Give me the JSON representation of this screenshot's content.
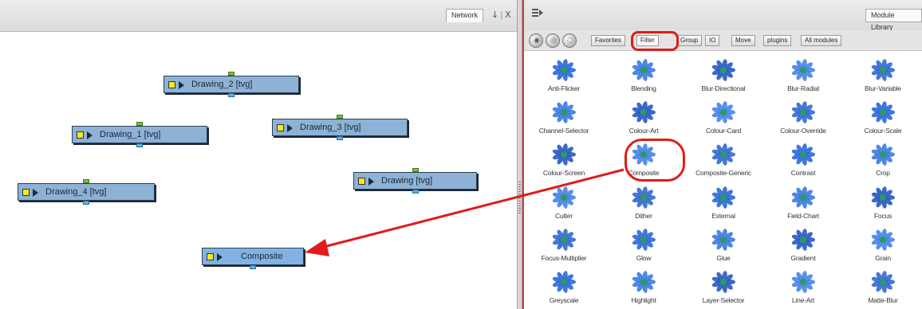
{
  "network": {
    "tab_label": "Network",
    "controls": [
      "↓",
      "|",
      "X"
    ],
    "nodes": [
      {
        "label": "Drawing_2  [tvg]",
        "selected": false
      },
      {
        "label": "Drawing_1  [tvg]",
        "selected": false
      },
      {
        "label": "Drawing_3  [tvg]",
        "selected": false
      },
      {
        "label": "Drawing  [tvg]",
        "selected": false
      },
      {
        "label": "Drawing_4  [tvg]",
        "selected": false
      },
      {
        "label": "Composite",
        "selected": true
      }
    ],
    "colors": {
      "node": "#8eb2d6",
      "node_selected": "#82b2e2",
      "input_port": "#7ac143",
      "output_port": "#58b4e6"
    }
  },
  "library": {
    "tab_label": "Module Library",
    "toolbar_icons": [
      "view-large-icon",
      "view-small-icon",
      "view-list-icon"
    ],
    "categories": [
      "Favorites",
      "Filter",
      "Group",
      "IO",
      "Move",
      "plugins",
      "All modules"
    ],
    "active_category": "Filter",
    "modules": [
      [
        "Anti-Flicker",
        "Blending",
        "Blur-Directional",
        "Blur-Radial",
        "Blur-Variable"
      ],
      [
        "Channel-Selector",
        "Colour-Art",
        "Colour-Card",
        "Colour-Override",
        "Colour-Scale"
      ],
      [
        "Colour-Screen",
        "Composite",
        "Composite-Generic",
        "Contrast",
        "Crop"
      ],
      [
        "Cutter",
        "Dither",
        "External",
        "Field-Chart",
        "Focus"
      ],
      [
        "Focus-Multiplier",
        "Glow",
        "Glue",
        "Gradient",
        "Grain"
      ],
      [
        "Greyscale",
        "Highlight",
        "Layer-Selector",
        "Line-Art",
        "Matte-Blur"
      ]
    ],
    "highlighted_module": "Composite"
  },
  "annotation": {
    "color": "#e11b1b"
  }
}
